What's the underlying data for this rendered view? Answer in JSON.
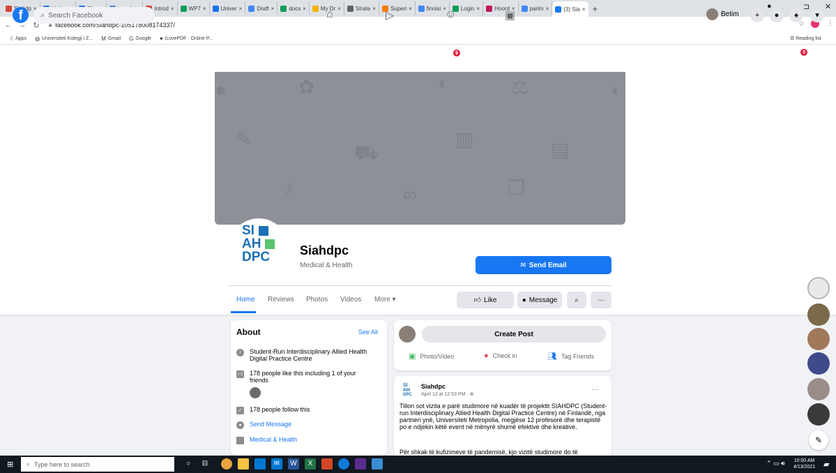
{
  "browser": {
    "tabs": [
      {
        "label": "Siahdp",
        "color": "#d44638"
      },
      {
        "label": "Univer",
        "color": "#1a73e8"
      },
      {
        "label": "SI ●",
        "color": "#1a73e8"
      },
      {
        "label": "transla",
        "color": "#4285f4"
      },
      {
        "label": "Introd",
        "color": "#d44638"
      },
      {
        "label": "WP7",
        "color": "#0f9d58"
      },
      {
        "label": "Univer",
        "color": "#1a73e8"
      },
      {
        "label": "Draft",
        "color": "#4285f4"
      },
      {
        "label": "docs",
        "color": "#0f9d58"
      },
      {
        "label": "My Dr",
        "color": "#f4b400"
      },
      {
        "label": "Strate",
        "color": "#5f6368"
      },
      {
        "label": "Superi",
        "color": "#f57c00"
      },
      {
        "label": "finnisi",
        "color": "#4285f4"
      },
      {
        "label": "Login",
        "color": "#0f9d58"
      },
      {
        "label": "Hoord",
        "color": "#c2185b"
      },
      {
        "label": "parim",
        "color": "#4285f4"
      },
      {
        "label": "(3) Sia",
        "color": "#1877f2",
        "active": true
      }
    ],
    "new_tab": "+",
    "url": "facebook.com/Siahdpc-105178008174337/",
    "bookmarks": [
      {
        "label": "Apps",
        "icon": "apps-grid-icon"
      },
      {
        "label": "Universiteti Kolegji i Z...",
        "icon": "globe-icon"
      },
      {
        "label": "Gmail",
        "icon": "gmail-icon"
      },
      {
        "label": "Google",
        "icon": "google-icon"
      },
      {
        "label": "iLovePDF · Online P...",
        "icon": "heart-icon"
      }
    ],
    "reading_list": "Reading list"
  },
  "fb": {
    "search_placeholder": "Search Facebook",
    "user_name": "Betim",
    "groups_badge": "9",
    "notif_badge": "3"
  },
  "page": {
    "name": "Siahdpc",
    "category": "Medical & Health",
    "logo_lines": [
      "SI",
      "AH",
      "DPC"
    ],
    "send_email": "Send Email",
    "tabs": [
      "Home",
      "Reviews",
      "Photos",
      "Videos",
      "More ▾"
    ],
    "like": "Like",
    "message": "Message",
    "search_icon": "search-icon",
    "more_dots": "···"
  },
  "about": {
    "title": "About",
    "see_all": "See All",
    "description": "Student-Run Interdisciplinary Allied Health Digital Practice Centre",
    "likes": "178 people like this including 1 of your friends",
    "follows": "178 people follow this",
    "send_message": "Send Message",
    "category": "Medical & Health"
  },
  "create_post": {
    "button": "Create Post",
    "photo_video": "Photo/Video",
    "check_in": "Check in",
    "tag_friends": "Tag Friends"
  },
  "post": {
    "author": "Siahdpc",
    "date": "April 12 at 12:53 PM · ⊕",
    "text": "Tillon sot vizita e parë studimore në kuadër të projektit SIAHDPC (Student-run Interdisciplinary Allied Health Digital Practice Centre) në Finlandë, nga partneri ynë, Universiteti Metropolia, megjëse 12 profesorë dhe terapistë po e ndjekin këtë event në mënyrë shumë efektive dhe kreative.",
    "text2": "Për shkak të kufizimeve të pandemisë, kjo vizitë studimore do të",
    "more": "···"
  },
  "taskbar": {
    "search_placeholder": "Type here to search",
    "time": "10:00 AM",
    "date": "4/13/2021"
  },
  "colors": {
    "fb_blue": "#1877f2",
    "bg": "#f0f2f5",
    "cover": "#8d9097",
    "badge": "#e41e3f"
  }
}
